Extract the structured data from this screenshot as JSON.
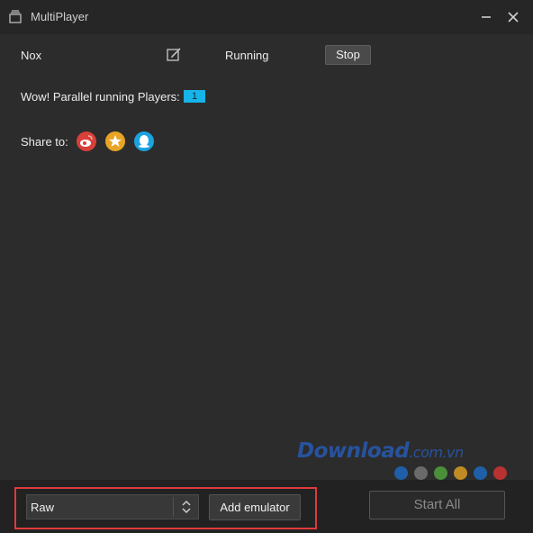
{
  "window": {
    "title": "MultiPlayer",
    "icons": {
      "app": "multiplayer-icon",
      "minimize": "minimize-icon",
      "close": "close-icon"
    }
  },
  "emulator": {
    "name": "Nox",
    "edit_icon": "edit-icon",
    "status": "Running",
    "stop_label": "Stop"
  },
  "parallel": {
    "text": "Wow! Parallel running Players:",
    "count": "1"
  },
  "share": {
    "label": "Share to:",
    "icons": [
      "weibo-icon",
      "qzone-icon",
      "qq-icon"
    ]
  },
  "watermark": {
    "text": "Download",
    "suffix": ".com.vn",
    "dot_colors": [
      "#1f5fa8",
      "#6a6a6a",
      "#4a8f3a",
      "#c08a25",
      "#1f5fa8",
      "#b83232"
    ]
  },
  "footer": {
    "select_value": "Raw",
    "add_label": "Add emulator",
    "start_label": "Start All"
  },
  "colors": {
    "background": "#2c2c2c",
    "titlebar": "#262626",
    "accent": "#16b4e8",
    "highlight": "#e03a3a"
  }
}
